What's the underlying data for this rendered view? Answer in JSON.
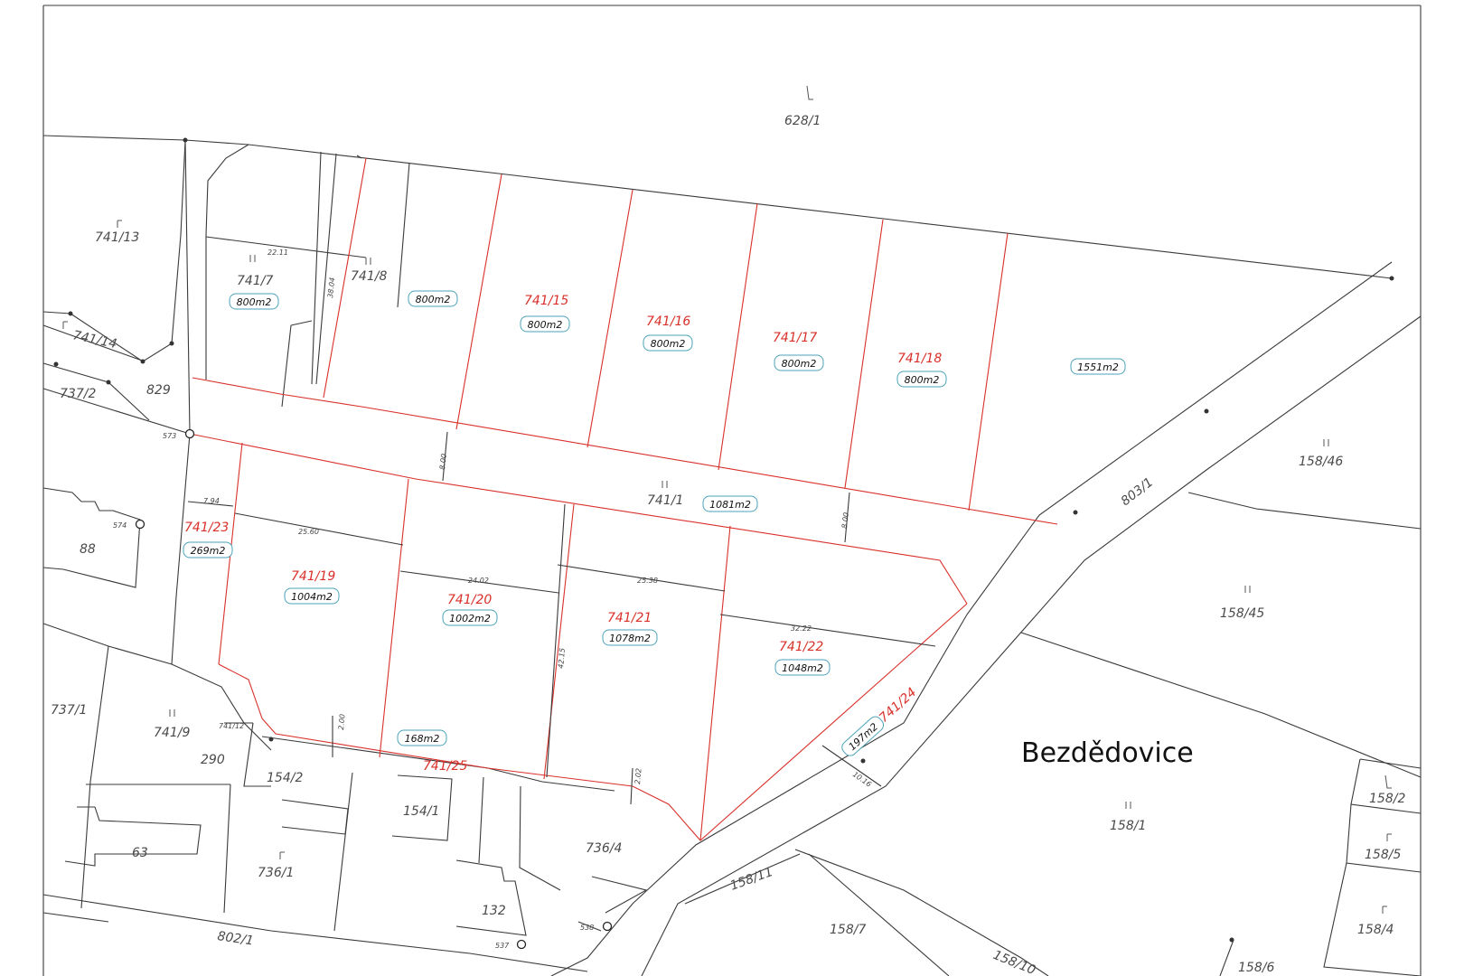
{
  "map": {
    "place_name": "Bezdědovice",
    "parcels_gray": [
      {
        "id": "p-628-1",
        "label": "628/1"
      },
      {
        "id": "p-741-13",
        "label": "741/13"
      },
      {
        "id": "p-741-14",
        "label": "741/14"
      },
      {
        "id": "p-737-2",
        "label": "737/2"
      },
      {
        "id": "p-829",
        "label": "829"
      },
      {
        "id": "p-741-7",
        "label": "741/7"
      },
      {
        "id": "p-741-8",
        "label": "741/8"
      },
      {
        "id": "p-741-1",
        "label": "741/1"
      },
      {
        "id": "p-88",
        "label": "88"
      },
      {
        "id": "p-737-1",
        "label": "737/1"
      },
      {
        "id": "p-741-9",
        "label": "741/9"
      },
      {
        "id": "p-741-12",
        "label": "741/12"
      },
      {
        "id": "p-290",
        "label": "290"
      },
      {
        "id": "p-154-2",
        "label": "154/2"
      },
      {
        "id": "p-154-1",
        "label": "154/1"
      },
      {
        "id": "p-63",
        "label": "63"
      },
      {
        "id": "p-736-1",
        "label": "736/1"
      },
      {
        "id": "p-736-4",
        "label": "736/4"
      },
      {
        "id": "p-132",
        "label": "132"
      },
      {
        "id": "p-802-1",
        "label": "802/1"
      },
      {
        "id": "p-803-1",
        "label": "803/1"
      },
      {
        "id": "p-158-46",
        "label": "158/46"
      },
      {
        "id": "p-158-45",
        "label": "158/45"
      },
      {
        "id": "p-158-1",
        "label": "158/1"
      },
      {
        "id": "p-158-2",
        "label": "158/2"
      },
      {
        "id": "p-158-5",
        "label": "158/5"
      },
      {
        "id": "p-158-4",
        "label": "158/4"
      },
      {
        "id": "p-158-11",
        "label": "158/11"
      },
      {
        "id": "p-158-7",
        "label": "158/7"
      },
      {
        "id": "p-158-10",
        "label": "158/10"
      },
      {
        "id": "p-158-6",
        "label": "158/6"
      }
    ],
    "parcels_red": [
      {
        "id": "p-741-15",
        "label": "741/15"
      },
      {
        "id": "p-741-16",
        "label": "741/16"
      },
      {
        "id": "p-741-17",
        "label": "741/17"
      },
      {
        "id": "p-741-18",
        "label": "741/18"
      },
      {
        "id": "p-741-23",
        "label": "741/23"
      },
      {
        "id": "p-741-19",
        "label": "741/19"
      },
      {
        "id": "p-741-20",
        "label": "741/20"
      },
      {
        "id": "p-741-21",
        "label": "741/21"
      },
      {
        "id": "p-741-22",
        "label": "741/22"
      },
      {
        "id": "p-741-24",
        "label": "741/24"
      },
      {
        "id": "p-741-25",
        "label": "741/25"
      }
    ],
    "areas": [
      {
        "id": "a-741-7",
        "label": "800m2"
      },
      {
        "id": "a-741-8",
        "label": "800m2"
      },
      {
        "id": "a-741-15",
        "label": "800m2"
      },
      {
        "id": "a-741-16",
        "label": "800m2"
      },
      {
        "id": "a-741-17",
        "label": "800m2"
      },
      {
        "id": "a-741-18",
        "label": "800m2"
      },
      {
        "id": "a-east",
        "label": "1551m2"
      },
      {
        "id": "a-741-1",
        "label": "1081m2"
      },
      {
        "id": "a-741-23",
        "label": "269m2"
      },
      {
        "id": "a-741-19",
        "label": "1004m2"
      },
      {
        "id": "a-741-20",
        "label": "1002m2"
      },
      {
        "id": "a-741-21",
        "label": "1078m2"
      },
      {
        "id": "a-741-22",
        "label": "1048m2"
      },
      {
        "id": "a-741-25",
        "label": "168m2"
      },
      {
        "id": "a-741-24",
        "label": "197m2"
      }
    ],
    "points": [
      {
        "id": "pt-573",
        "label": "573"
      },
      {
        "id": "pt-574",
        "label": "574"
      },
      {
        "id": "pt-537",
        "label": "537"
      },
      {
        "id": "pt-538",
        "label": "538"
      }
    ],
    "dimensions": [
      {
        "id": "d-1",
        "label": "22.11"
      },
      {
        "id": "d-2",
        "label": "38.04"
      },
      {
        "id": "d-3",
        "label": "8.00"
      },
      {
        "id": "d-4",
        "label": "8.00"
      },
      {
        "id": "d-5",
        "label": "7.94"
      },
      {
        "id": "d-6",
        "label": "25.60"
      },
      {
        "id": "d-7",
        "label": "24.02"
      },
      {
        "id": "d-8",
        "label": "25.38"
      },
      {
        "id": "d-9",
        "label": "32.22"
      },
      {
        "id": "d-10",
        "label": "42.15"
      },
      {
        "id": "d-11",
        "label": "2.00"
      },
      {
        "id": "d-12",
        "label": "2.02"
      },
      {
        "id": "d-13",
        "label": "10.16"
      }
    ]
  }
}
